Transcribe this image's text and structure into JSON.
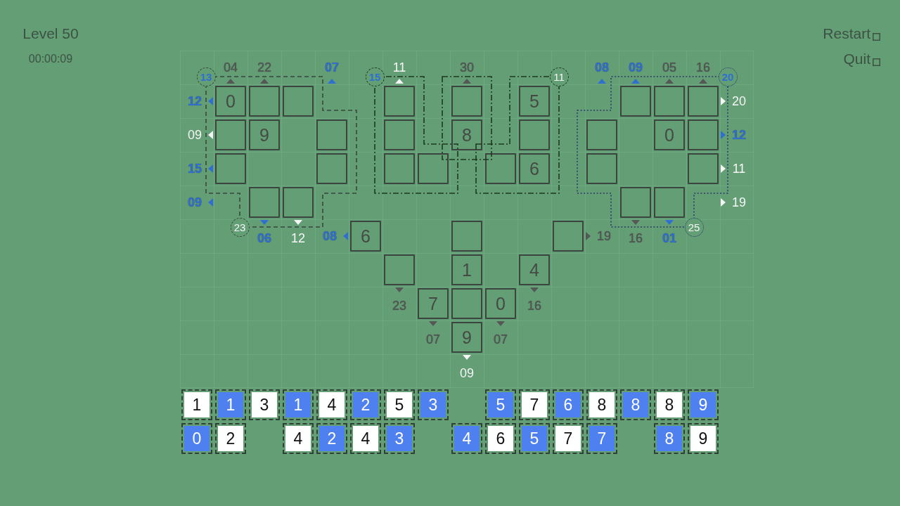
{
  "level": {
    "title": "Level 50",
    "timer": "00:00:09"
  },
  "menu": [
    {
      "label": "Restart"
    },
    {
      "label": "Quit"
    }
  ],
  "board": {
    "rows": [
      [
        {
          "kind": "blank"
        },
        {
          "kind": "clue-up",
          "text": "04",
          "color": "#555756"
        },
        {
          "kind": "clue-up",
          "text": "22",
          "color": "#555756"
        },
        {
          "kind": "blank"
        },
        {
          "kind": "clue-up",
          "text": "07",
          "color": "#2f6fd3"
        },
        {
          "kind": "blank"
        },
        {
          "kind": "clue-up",
          "text": "11",
          "color": "#f6f6f6"
        },
        {
          "kind": "blank"
        },
        {
          "kind": "clue-up",
          "text": "30",
          "color": "#555756"
        },
        {
          "kind": "blank"
        },
        {
          "kind": "blank"
        },
        {
          "kind": "blank"
        },
        {
          "kind": "clue-up",
          "text": "08",
          "color": "#2f6fd3"
        },
        {
          "kind": "clue-up",
          "text": "09",
          "color": "#2f6fd3"
        },
        {
          "kind": "clue-up",
          "text": "05",
          "color": "#555756"
        },
        {
          "kind": "clue-up",
          "text": "16",
          "color": "#555756"
        }
      ],
      [
        {
          "kind": "clue-left",
          "text": "12",
          "color": "#2f6fd3"
        },
        {
          "kind": "box",
          "value": "0",
          "cage": {
            "kind": "dashed"
          },
          "cage_total": {
            "kind": "top-left",
            "text": "13",
            "color": "#2f6fd3"
          }
        },
        {
          "kind": "box",
          "cage": {
            "kind": "dashed"
          }
        },
        {
          "kind": "box",
          "cage": {
            "kind": "dashed"
          }
        },
        {
          "kind": "blank"
        },
        {
          "kind": "blank"
        },
        {
          "kind": "box",
          "cage": {
            "kind": "dash-dot"
          },
          "cage_total": {
            "kind": "top-left",
            "text": "15",
            "color": "#2f6fd3"
          }
        },
        {
          "kind": "blank"
        },
        {
          "kind": "box",
          "cage": {
            "kind": "dash-dot"
          }
        },
        {
          "kind": "blank"
        },
        {
          "kind": "box",
          "value": "5",
          "cage": {
            "kind": "dash-dot"
          },
          "cage_total": {
            "kind": "top-right",
            "text": "11",
            "color": "#f6f6f6"
          }
        },
        {
          "kind": "blank"
        },
        {
          "kind": "blank"
        },
        {
          "kind": "box",
          "cage": {
            "kind": "dotted"
          }
        },
        {
          "kind": "box",
          "cage": {
            "kind": "dotted"
          }
        },
        {
          "kind": "box",
          "cage": {
            "kind": "dotted"
          },
          "cage_total": {
            "kind": "top-right",
            "text": "20",
            "color": "#2f6fd3"
          }
        },
        {
          "kind": "clue-right",
          "text": "20",
          "color": "#f6f6f6"
        }
      ],
      [
        {
          "kind": "clue-left",
          "text": "09",
          "color": "#f6f6f6"
        },
        {
          "kind": "box",
          "cage": {
            "kind": "dashed"
          }
        },
        {
          "kind": "box",
          "value": "9",
          "cage": {
            "kind": "dashed"
          }
        },
        {
          "kind": "blank",
          "cage": {
            "kind": "dashed"
          }
        },
        {
          "kind": "box",
          "cage": {
            "kind": "dashed"
          }
        },
        {
          "kind": "blank"
        },
        {
          "kind": "box",
          "cage": {
            "kind": "dash-dot"
          }
        },
        {
          "kind": "blank"
        },
        {
          "kind": "box",
          "value": "8",
          "cage": {
            "kind": "dash-dot"
          }
        },
        {
          "kind": "blank"
        },
        {
          "kind": "box",
          "cage": {
            "kind": "dash-dot"
          }
        },
        {
          "kind": "blank"
        },
        {
          "kind": "box",
          "cage": {
            "kind": "dotted"
          }
        },
        {
          "kind": "blank",
          "cage": {
            "kind": "dotted"
          }
        },
        {
          "kind": "box",
          "value": "0",
          "cage": {
            "kind": "dotted"
          }
        },
        {
          "kind": "box",
          "cage": {
            "kind": "dotted"
          }
        },
        {
          "kind": "clue-right",
          "text": "12",
          "color": "#2f6fd3"
        }
      ],
      [
        {
          "kind": "clue-left",
          "text": "15",
          "color": "#2f6fd3"
        },
        {
          "kind": "box",
          "cage": {
            "kind": "dashed"
          }
        },
        {
          "kind": "blank",
          "cage": {
            "kind": "dashed"
          }
        },
        {
          "kind": "blank",
          "cage": {
            "kind": "dashed"
          }
        },
        {
          "kind": "box",
          "cage": {
            "kind": "dashed"
          }
        },
        {
          "kind": "blank"
        },
        {
          "kind": "box",
          "cage": {
            "kind": "dash-dot"
          }
        },
        {
          "kind": "box",
          "cage": {
            "kind": "dash-dot"
          }
        },
        {
          "kind": "blank"
        },
        {
          "kind": "box",
          "cage": {
            "kind": "dash-dot"
          }
        },
        {
          "kind": "box",
          "value": "6",
          "cage": {
            "kind": "dash-dot"
          }
        },
        {
          "kind": "blank"
        },
        {
          "kind": "box",
          "cage": {
            "kind": "dotted"
          }
        },
        {
          "kind": "blank",
          "cage": {
            "kind": "dotted"
          }
        },
        {
          "kind": "blank",
          "cage": {
            "kind": "dotted"
          }
        },
        {
          "kind": "box",
          "cage": {
            "kind": "dotted"
          }
        },
        {
          "kind": "clue-right",
          "text": "11",
          "color": "#f6f6f6"
        }
      ],
      [
        {
          "kind": "clue-left",
          "text": "09",
          "color": "#2f6fd3"
        },
        {
          "kind": "blank"
        },
        {
          "kind": "box",
          "cage": {
            "kind": "dashed"
          },
          "cage_total": {
            "kind": "bottom-left",
            "text": "23",
            "color": "#f6f6f6"
          }
        },
        {
          "kind": "box",
          "cage": {
            "kind": "dashed"
          }
        },
        {
          "kind": "blank"
        },
        {
          "kind": "blank"
        },
        {
          "kind": "blank"
        },
        {
          "kind": "blank"
        },
        {
          "kind": "blank"
        },
        {
          "kind": "blank"
        },
        {
          "kind": "blank"
        },
        {
          "kind": "blank"
        },
        {
          "kind": "blank"
        },
        {
          "kind": "box",
          "cage": {
            "kind": "dotted"
          }
        },
        {
          "kind": "box",
          "cage": {
            "kind": "dotted"
          },
          "cage_total": {
            "kind": "bottom-right",
            "text": "25",
            "color": "#f6f6f6"
          }
        },
        {
          "kind": "blank"
        },
        {
          "kind": "clue-right",
          "text": "19",
          "color": "#f6f6f6"
        }
      ],
      [
        {
          "kind": "blank"
        },
        {
          "kind": "blank"
        },
        {
          "kind": "clue-down",
          "text": "06",
          "color": "#2f6fd3"
        },
        {
          "kind": "clue-down",
          "text": "12",
          "color": "#f6f6f6"
        },
        {
          "kind": "clue-left",
          "text": "08",
          "color": "#2f6fd3"
        },
        {
          "kind": "box",
          "value": "6"
        },
        {
          "kind": "blank"
        },
        {
          "kind": "blank"
        },
        {
          "kind": "box"
        },
        {
          "kind": "blank"
        },
        {
          "kind": "blank"
        },
        {
          "kind": "box"
        },
        {
          "kind": "clue-right",
          "text": "19",
          "color": "#555756"
        },
        {
          "kind": "clue-down",
          "text": "16",
          "color": "#555756"
        },
        {
          "kind": "clue-down",
          "text": "01",
          "color": "#2f6fd3"
        }
      ],
      [
        {
          "kind": "blank"
        },
        {
          "kind": "blank"
        },
        {
          "kind": "blank"
        },
        {
          "kind": "blank"
        },
        {
          "kind": "blank"
        },
        {
          "kind": "blank"
        },
        {
          "kind": "box"
        },
        {
          "kind": "blank"
        },
        {
          "kind": "box",
          "value": "1"
        },
        {
          "kind": "blank"
        },
        {
          "kind": "box",
          "value": "4"
        }
      ],
      [
        {
          "kind": "blank"
        },
        {
          "kind": "blank"
        },
        {
          "kind": "blank"
        },
        {
          "kind": "blank"
        },
        {
          "kind": "blank"
        },
        {
          "kind": "blank"
        },
        {
          "kind": "clue-down",
          "text": "23",
          "color": "#555756"
        },
        {
          "kind": "box",
          "value": "7"
        },
        {
          "kind": "box"
        },
        {
          "kind": "box",
          "value": "0"
        },
        {
          "kind": "clue-down",
          "text": "16",
          "color": "#555756"
        }
      ],
      [
        {
          "kind": "blank"
        },
        {
          "kind": "blank"
        },
        {
          "kind": "blank"
        },
        {
          "kind": "blank"
        },
        {
          "kind": "blank"
        },
        {
          "kind": "blank"
        },
        {
          "kind": "blank"
        },
        {
          "kind": "clue-down",
          "text": "07",
          "color": "#555756"
        },
        {
          "kind": "box",
          "value": "9"
        },
        {
          "kind": "clue-down",
          "text": "07",
          "color": "#555756"
        }
      ],
      [
        {
          "kind": "blank"
        },
        {
          "kind": "blank"
        },
        {
          "kind": "blank"
        },
        {
          "kind": "blank"
        },
        {
          "kind": "blank"
        },
        {
          "kind": "blank"
        },
        {
          "kind": "blank"
        },
        {
          "kind": "blank"
        },
        {
          "kind": "clue-down",
          "text": "09",
          "color": "#f6f6f6"
        }
      ]
    ]
  },
  "tray": {
    "rows": [
      [
        {
          "kind": "tile",
          "value": "1",
          "color": "#ffffff"
        },
        {
          "kind": "tile",
          "value": "1",
          "color": "#4f80f0"
        },
        {
          "kind": "tile",
          "value": "3",
          "color": "#ffffff"
        },
        {
          "kind": "tile",
          "value": "1",
          "color": "#4f80f0"
        },
        {
          "kind": "tile",
          "value": "4",
          "color": "#ffffff"
        },
        {
          "kind": "tile",
          "value": "2",
          "color": "#4f80f0"
        },
        {
          "kind": "tile",
          "value": "5",
          "color": "#ffffff"
        },
        {
          "kind": "tile",
          "value": "3",
          "color": "#4f80f0"
        },
        {
          "kind": "gap"
        },
        {
          "kind": "tile",
          "value": "5",
          "color": "#4f80f0"
        },
        {
          "kind": "tile",
          "value": "7",
          "color": "#ffffff"
        },
        {
          "kind": "tile",
          "value": "6",
          "color": "#4f80f0"
        },
        {
          "kind": "tile",
          "value": "8",
          "color": "#ffffff"
        },
        {
          "kind": "tile",
          "value": "8",
          "color": "#4f80f0"
        },
        {
          "kind": "tile",
          "value": "8",
          "color": "#ffffff"
        },
        {
          "kind": "tile",
          "value": "9",
          "color": "#4f80f0"
        }
      ],
      [
        {
          "kind": "tile",
          "value": "0",
          "color": "#4f80f0"
        },
        {
          "kind": "tile",
          "value": "2",
          "color": "#ffffff"
        },
        {
          "kind": "gap"
        },
        {
          "kind": "tile",
          "value": "4",
          "color": "#ffffff"
        },
        {
          "kind": "tile",
          "value": "2",
          "color": "#4f80f0"
        },
        {
          "kind": "tile",
          "value": "4",
          "color": "#ffffff"
        },
        {
          "kind": "tile",
          "value": "3",
          "color": "#4f80f0"
        },
        {
          "kind": "gap"
        },
        {
          "kind": "tile",
          "value": "4",
          "color": "#4f80f0"
        },
        {
          "kind": "tile",
          "value": "6",
          "color": "#ffffff"
        },
        {
          "kind": "tile",
          "value": "5",
          "color": "#4f80f0"
        },
        {
          "kind": "tile",
          "value": "7",
          "color": "#ffffff"
        },
        {
          "kind": "tile",
          "value": "7",
          "color": "#4f80f0"
        },
        {
          "kind": "gap"
        },
        {
          "kind": "tile",
          "value": "8",
          "color": "#4f80f0"
        },
        {
          "kind": "tile",
          "value": "9",
          "color": "#ffffff"
        }
      ]
    ]
  }
}
